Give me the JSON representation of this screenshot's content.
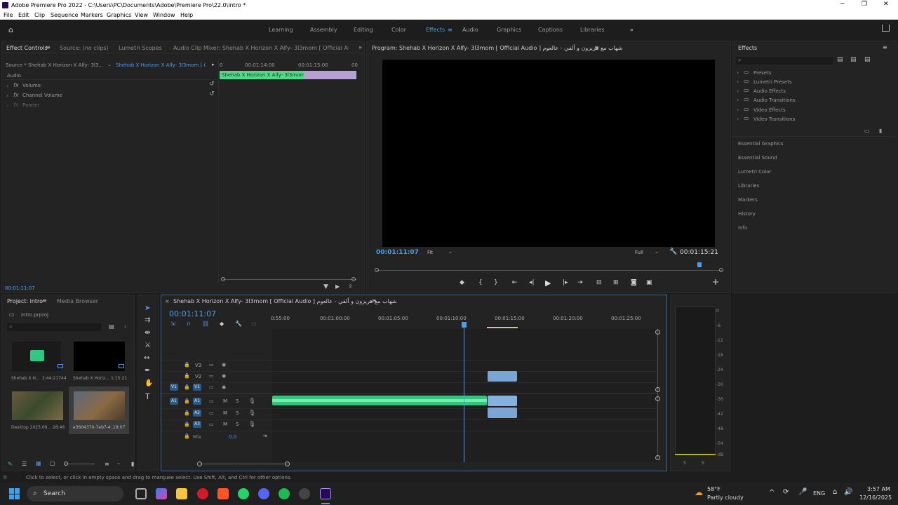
{
  "app": {
    "title": "Adobe Premiere Pro 2022 - C:\\Users\\PC\\Documents\\Adobe\\Premiere Pro\\22.0\\intro *",
    "win_min": "─",
    "win_max": "❐",
    "win_close": "✕"
  },
  "menu": [
    "File",
    "Edit",
    "Clip",
    "Sequence",
    "Markers",
    "Graphics",
    "View",
    "Window",
    "Help"
  ],
  "workspaces": {
    "learning": "Learning",
    "assembly": "Assembly",
    "editing": "Editing",
    "color": "Color",
    "effects": "Effects",
    "audio": "Audio",
    "graphics": "Graphics",
    "captions": "Captions",
    "libraries": "Libraries",
    "more": "»"
  },
  "source_panel": {
    "tabs": [
      "Effect Controls",
      "Source: (no clips)",
      "Lumetri Scopes",
      "Audio Clip Mixer: Shehab X Horizon X Alfy- 3l3mom [ Official Audio ] عالعوم"
    ],
    "source_label": "Source * Shehab X Horizon X Alfy- 3l3...",
    "seq_label": "Shehab X Horizon X Alfy- 3l3mom [ O...",
    "section": "Audio",
    "rows": [
      "Volume",
      "Channel Volume",
      "Panner"
    ],
    "ruler": [
      "0",
      "00:01:14:00",
      "00:01:15:00",
      "00"
    ],
    "clip_label": "Shehab X Horizon X Alfy- 3l3mom",
    "timecode": "00:01:11:07"
  },
  "program": {
    "title": "Program: Shehab X Horizon X Alfy- 3l3mom [ Official Audio ] شهاب مع هريزون و ألفي - عالعوم",
    "timecode": "00:01:11:07",
    "fit": "Fit",
    "quality": "Full",
    "duration": "00:01:15:21"
  },
  "effects_panel": {
    "title": "Effects",
    "folders": [
      "Presets",
      "Lumetri Presets",
      "Audio Effects",
      "Audio Transitions",
      "Video Effects",
      "Video Transitions"
    ],
    "sections": [
      "Essential Graphics",
      "Essential Sound",
      "Lumetri Color",
      "Libraries",
      "Markers",
      "History",
      "Info"
    ]
  },
  "project": {
    "tabs": [
      "Project: intro",
      "Media Browser"
    ],
    "file": "intro.prproj",
    "items": [
      {
        "name": "Shehab X H...",
        "dur": "2:44:21744"
      },
      {
        "name": "Shehab X Horiz...",
        "dur": "1:15:21"
      },
      {
        "name": "Desktop 2025.09...",
        "dur": "28:46"
      },
      {
        "name": "e3604370-7eb7-4...",
        "dur": "19:07"
      }
    ]
  },
  "timeline": {
    "title": "Shehab X Horizon X Alfy- 3l3mom [ Official Audio ] شهاب مع هريزون و ألفي - عالعوم",
    "timecode": "00:01:11:07",
    "ruler": [
      "0:55:00",
      "00:01:00:00",
      "00:01:05:00",
      "00:01:10:00",
      "00:01:15:00",
      "00:01:20:00",
      "00:01:25:00"
    ],
    "tracks_v": [
      "V3",
      "V2",
      "V1"
    ],
    "tracks_a": [
      "A1",
      "A2",
      "A3"
    ],
    "mix": "Mix",
    "mix_val": "0.0",
    "m": "M",
    "s": "S",
    "meter_scale": [
      "0",
      "-6",
      "-12",
      "-18",
      "-24",
      "-30",
      "-36",
      "-42",
      "-48",
      "-54",
      "-dB"
    ],
    "meter_ss": [
      "S",
      "S"
    ]
  },
  "status": "Click to select, or click in empty space and drag to marquee select. Use Shift, Alt, and Ctrl for other options.",
  "taskbar": {
    "search": "Search",
    "weather_temp": "58°F",
    "weather_desc": "Partly cloudy",
    "lang": "ENG",
    "time": "3:57 AM",
    "date": "12/16/2025"
  },
  "colors": {
    "accent": "#4d9cf0",
    "clip_green": "#4ddb8a",
    "clip_blue": "#7aa6d6",
    "playhead": "#4d9cf0"
  }
}
